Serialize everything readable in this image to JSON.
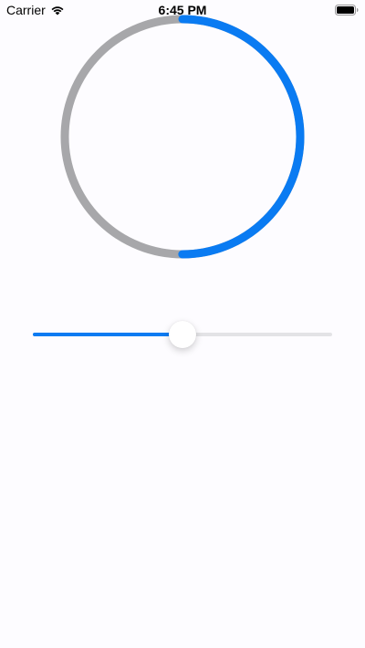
{
  "status_bar": {
    "carrier": "Carrier",
    "time": "6:45 PM",
    "wifi_icon": "wifi-icon",
    "battery_icon": "battery-icon"
  },
  "progress_ring": {
    "progress": 0.5,
    "track_color": "#a7a7aa",
    "progress_color": "#0a7bf2"
  },
  "slider": {
    "value": 0.5,
    "fill_color": "#0a7bf2",
    "track_color": "#e3e3e6"
  }
}
